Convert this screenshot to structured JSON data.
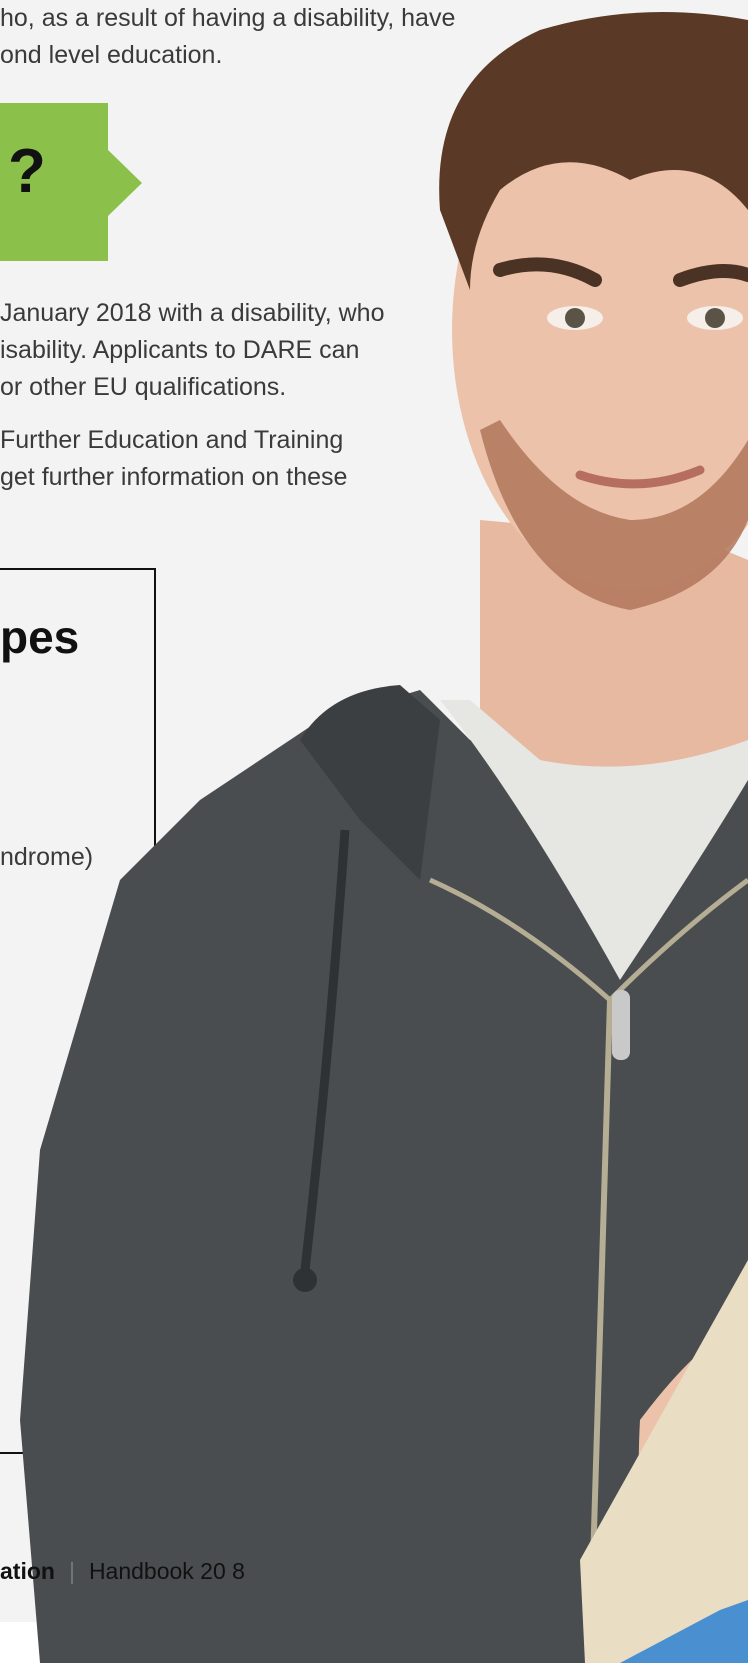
{
  "intro": {
    "lines": [
      "ho, as a result of having a disability, have",
      "ond level education."
    ]
  },
  "flag": {
    "text": "?",
    "color": "#8bc04a"
  },
  "paragraph1": {
    "lines": [
      "January 2018 with a disability, who",
      "isability. Applicants to DARE can",
      "or other EU qualifications."
    ]
  },
  "paragraph2": {
    "lines": [
      "Further Education and Training",
      "get further information on these"
    ]
  },
  "box": {
    "heading": "pes",
    "item": "ndrome)"
  },
  "footer": {
    "left": "ation",
    "separator": "|",
    "right": "Handbook 20 8"
  }
}
